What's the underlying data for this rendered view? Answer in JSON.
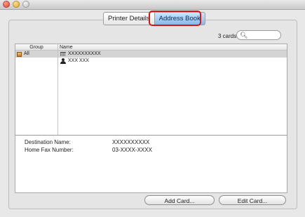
{
  "tabs": [
    {
      "label": "Printer Details",
      "active": false
    },
    {
      "label": "Address Book",
      "active": true
    }
  ],
  "cards_count": "3 cards",
  "search": {
    "placeholder": "",
    "value": ""
  },
  "columns": {
    "group": "Group",
    "name": "Name"
  },
  "groups": [
    {
      "label": "All",
      "icon": "group-folder-icon",
      "selected": true
    }
  ],
  "entries": [
    {
      "name": "XXXXXXXXXX",
      "icon": "building-icon",
      "selected": true
    },
    {
      "name": "XXX XXX",
      "icon": "person-icon",
      "selected": false
    }
  ],
  "details": {
    "destination_name_label": "Destination Name:",
    "destination_name_value": "XXXXXXXXXX",
    "home_fax_label": "Home Fax Number:",
    "home_fax_value": "03-XXXX-XXXX"
  },
  "buttons": {
    "add_card": "Add Card...",
    "edit_card": "Edit Card..."
  },
  "colors": {
    "highlight": "#cc1a1a",
    "active_tab": "#86b8ec"
  }
}
